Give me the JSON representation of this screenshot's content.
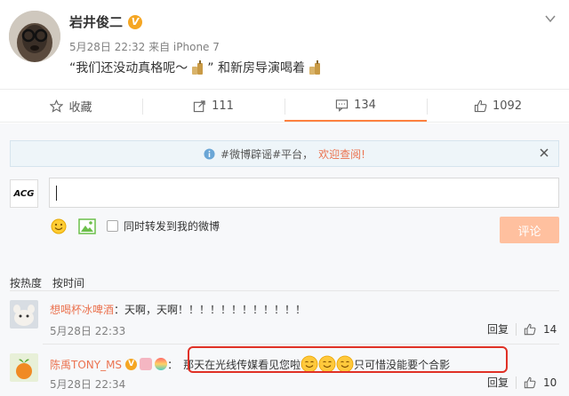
{
  "post": {
    "author": "岩井俊二",
    "meta": "5月28日 22:32 来自 iPhone 7",
    "text_part1": "“我们还没动真格呢～",
    "text_part2": "” 和新房导演喝着"
  },
  "actions": [
    {
      "icon": "star-icon",
      "label": "收藏"
    },
    {
      "icon": "share-icon",
      "label": "111"
    },
    {
      "icon": "comment-icon",
      "label": "134"
    },
    {
      "icon": "like-icon",
      "label": "1092"
    }
  ],
  "notice": {
    "text": "#微博辟谣#平台，",
    "link": "欢迎查阅!"
  },
  "composer": {
    "user_logo": "ACG",
    "input_value": "",
    "repost_label": "同时转发到我的微博",
    "submit_label": "评论"
  },
  "sort": {
    "hot_label": "按热度",
    "time_label": "按时间"
  },
  "comments": [
    {
      "name": "想喝杯冰啤酒",
      "text": "：天啊，天啊！！！！！！！！！！！！",
      "time": "5月28日 22:33",
      "reply_label": "回复",
      "likes": "14"
    },
    {
      "name": "陈禹TONY_MS",
      "text_part1": "那天在光线传媒看见您啦",
      "text_part2": " 只可惜没能要个合影",
      "time": "5月28日 22:34",
      "reply_label": "回复",
      "likes": "10"
    }
  ],
  "colors": {
    "link_orange": "#eb7350",
    "submit_disabled": "#ffc09f",
    "highlight_red": "#e03126",
    "verified_gold": "#f5a623"
  }
}
